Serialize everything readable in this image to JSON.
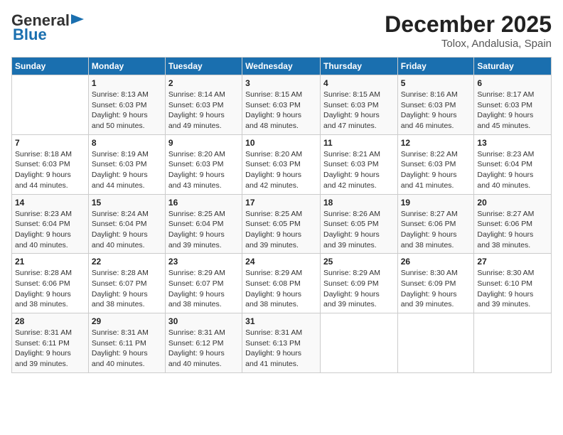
{
  "logo": {
    "line1": "General",
    "line2": "Blue"
  },
  "header": {
    "month": "December 2025",
    "location": "Tolox, Andalusia, Spain"
  },
  "days_of_week": [
    "Sunday",
    "Monday",
    "Tuesday",
    "Wednesday",
    "Thursday",
    "Friday",
    "Saturday"
  ],
  "weeks": [
    [
      {
        "day": "",
        "info": ""
      },
      {
        "day": "1",
        "info": "Sunrise: 8:13 AM\nSunset: 6:03 PM\nDaylight: 9 hours\nand 50 minutes."
      },
      {
        "day": "2",
        "info": "Sunrise: 8:14 AM\nSunset: 6:03 PM\nDaylight: 9 hours\nand 49 minutes."
      },
      {
        "day": "3",
        "info": "Sunrise: 8:15 AM\nSunset: 6:03 PM\nDaylight: 9 hours\nand 48 minutes."
      },
      {
        "day": "4",
        "info": "Sunrise: 8:15 AM\nSunset: 6:03 PM\nDaylight: 9 hours\nand 47 minutes."
      },
      {
        "day": "5",
        "info": "Sunrise: 8:16 AM\nSunset: 6:03 PM\nDaylight: 9 hours\nand 46 minutes."
      },
      {
        "day": "6",
        "info": "Sunrise: 8:17 AM\nSunset: 6:03 PM\nDaylight: 9 hours\nand 45 minutes."
      }
    ],
    [
      {
        "day": "7",
        "info": "Sunrise: 8:18 AM\nSunset: 6:03 PM\nDaylight: 9 hours\nand 44 minutes."
      },
      {
        "day": "8",
        "info": "Sunrise: 8:19 AM\nSunset: 6:03 PM\nDaylight: 9 hours\nand 44 minutes."
      },
      {
        "day": "9",
        "info": "Sunrise: 8:20 AM\nSunset: 6:03 PM\nDaylight: 9 hours\nand 43 minutes."
      },
      {
        "day": "10",
        "info": "Sunrise: 8:20 AM\nSunset: 6:03 PM\nDaylight: 9 hours\nand 42 minutes."
      },
      {
        "day": "11",
        "info": "Sunrise: 8:21 AM\nSunset: 6:03 PM\nDaylight: 9 hours\nand 42 minutes."
      },
      {
        "day": "12",
        "info": "Sunrise: 8:22 AM\nSunset: 6:03 PM\nDaylight: 9 hours\nand 41 minutes."
      },
      {
        "day": "13",
        "info": "Sunrise: 8:23 AM\nSunset: 6:04 PM\nDaylight: 9 hours\nand 40 minutes."
      }
    ],
    [
      {
        "day": "14",
        "info": "Sunrise: 8:23 AM\nSunset: 6:04 PM\nDaylight: 9 hours\nand 40 minutes."
      },
      {
        "day": "15",
        "info": "Sunrise: 8:24 AM\nSunset: 6:04 PM\nDaylight: 9 hours\nand 40 minutes."
      },
      {
        "day": "16",
        "info": "Sunrise: 8:25 AM\nSunset: 6:04 PM\nDaylight: 9 hours\nand 39 minutes."
      },
      {
        "day": "17",
        "info": "Sunrise: 8:25 AM\nSunset: 6:05 PM\nDaylight: 9 hours\nand 39 minutes."
      },
      {
        "day": "18",
        "info": "Sunrise: 8:26 AM\nSunset: 6:05 PM\nDaylight: 9 hours\nand 39 minutes."
      },
      {
        "day": "19",
        "info": "Sunrise: 8:27 AM\nSunset: 6:06 PM\nDaylight: 9 hours\nand 38 minutes."
      },
      {
        "day": "20",
        "info": "Sunrise: 8:27 AM\nSunset: 6:06 PM\nDaylight: 9 hours\nand 38 minutes."
      }
    ],
    [
      {
        "day": "21",
        "info": "Sunrise: 8:28 AM\nSunset: 6:06 PM\nDaylight: 9 hours\nand 38 minutes."
      },
      {
        "day": "22",
        "info": "Sunrise: 8:28 AM\nSunset: 6:07 PM\nDaylight: 9 hours\nand 38 minutes."
      },
      {
        "day": "23",
        "info": "Sunrise: 8:29 AM\nSunset: 6:07 PM\nDaylight: 9 hours\nand 38 minutes."
      },
      {
        "day": "24",
        "info": "Sunrise: 8:29 AM\nSunset: 6:08 PM\nDaylight: 9 hours\nand 38 minutes."
      },
      {
        "day": "25",
        "info": "Sunrise: 8:29 AM\nSunset: 6:09 PM\nDaylight: 9 hours\nand 39 minutes."
      },
      {
        "day": "26",
        "info": "Sunrise: 8:30 AM\nSunset: 6:09 PM\nDaylight: 9 hours\nand 39 minutes."
      },
      {
        "day": "27",
        "info": "Sunrise: 8:30 AM\nSunset: 6:10 PM\nDaylight: 9 hours\nand 39 minutes."
      }
    ],
    [
      {
        "day": "28",
        "info": "Sunrise: 8:31 AM\nSunset: 6:11 PM\nDaylight: 9 hours\nand 39 minutes."
      },
      {
        "day": "29",
        "info": "Sunrise: 8:31 AM\nSunset: 6:11 PM\nDaylight: 9 hours\nand 40 minutes."
      },
      {
        "day": "30",
        "info": "Sunrise: 8:31 AM\nSunset: 6:12 PM\nDaylight: 9 hours\nand 40 minutes."
      },
      {
        "day": "31",
        "info": "Sunrise: 8:31 AM\nSunset: 6:13 PM\nDaylight: 9 hours\nand 41 minutes."
      },
      {
        "day": "",
        "info": ""
      },
      {
        "day": "",
        "info": ""
      },
      {
        "day": "",
        "info": ""
      }
    ]
  ]
}
